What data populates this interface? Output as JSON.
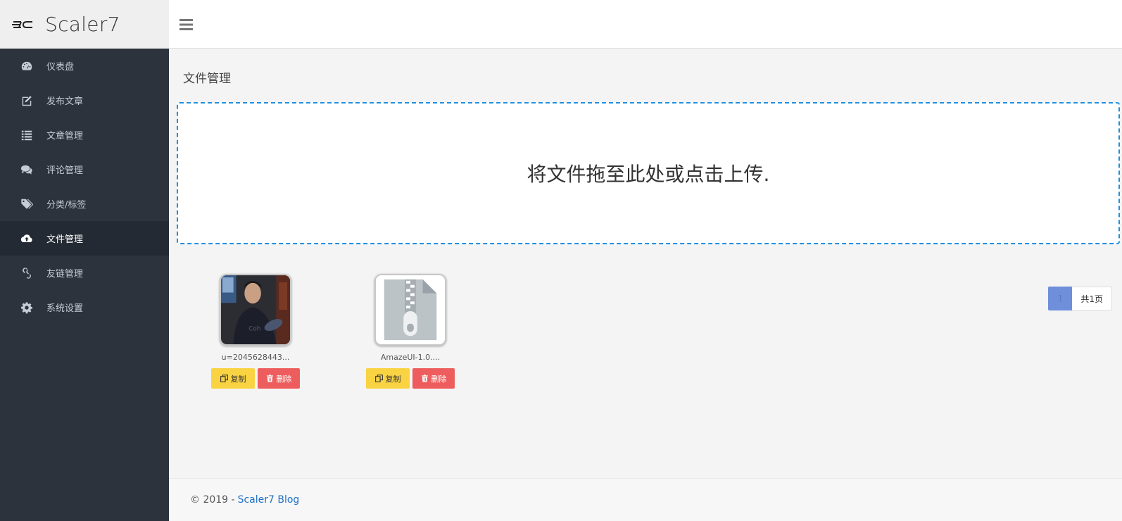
{
  "brand": {
    "name": "Scaler7"
  },
  "sidebar": {
    "items": [
      {
        "label": "仪表盘",
        "icon": "dashboard-icon",
        "active": false
      },
      {
        "label": "发布文章",
        "icon": "edit-icon",
        "active": false
      },
      {
        "label": "文章管理",
        "icon": "list-icon",
        "active": false
      },
      {
        "label": "评论管理",
        "icon": "comments-icon",
        "active": false
      },
      {
        "label": "分类/标签",
        "icon": "tags-icon",
        "active": false
      },
      {
        "label": "文件管理",
        "icon": "cloud-upload-icon",
        "active": true
      },
      {
        "label": "友链管理",
        "icon": "link-icon",
        "active": false
      },
      {
        "label": "系统设置",
        "icon": "gear-icon",
        "active": false
      }
    ]
  },
  "main": {
    "title": "文件管理",
    "dropzone_text": "将文件拖至此处或点击上传.",
    "files": [
      {
        "name": "u=2045628443...",
        "type": "image",
        "copy_label": "复制",
        "delete_label": "删除"
      },
      {
        "name": "AmazeUI-1.0....",
        "type": "zip",
        "copy_label": "复制",
        "delete_label": "删除"
      }
    ],
    "pagination": {
      "current": "1",
      "total_text": "共1页"
    }
  },
  "footer": {
    "copyright": "© 2019 -",
    "link_text": "Scaler7 Blog"
  },
  "colors": {
    "sidebar_bg": "#2d333d",
    "accent": "#1e8fe1",
    "copy": "#f9d342",
    "delete": "#ee5d5d",
    "page_active": "#6f8fdb"
  }
}
